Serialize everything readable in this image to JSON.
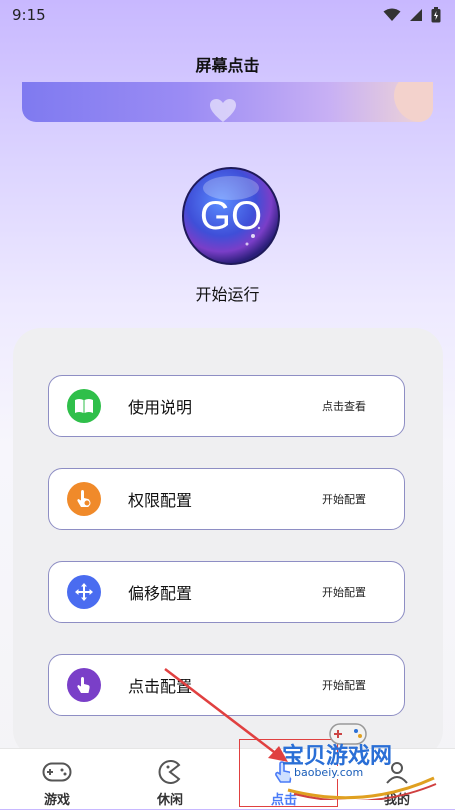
{
  "status_bar": {
    "time": "9:15"
  },
  "header": {
    "title": "屏幕点击"
  },
  "go_button": {
    "label": "GO",
    "caption": "开始运行"
  },
  "menu": [
    {
      "label": "使用说明",
      "action": "点击查看",
      "icon": "book-icon",
      "color": "#2fbf4a"
    },
    {
      "label": "权限配置",
      "action": "开始配置",
      "icon": "touch-shield-icon",
      "color": "#f08a2a"
    },
    {
      "label": "偏移配置",
      "action": "开始配置",
      "icon": "move-arrows-icon",
      "color": "#4a6cf0"
    },
    {
      "label": "点击配置",
      "action": "开始配置",
      "icon": "hand-tap-icon",
      "color": "#7a3fc8"
    }
  ],
  "nav": [
    {
      "label": "游戏",
      "icon": "gamepad-icon"
    },
    {
      "label": "休闲",
      "icon": "pacman-icon"
    },
    {
      "label": "点击",
      "icon": "tap-hand-icon",
      "active": true
    },
    {
      "label": "我的",
      "icon": "profile-icon"
    }
  ],
  "watermark": {
    "main": "宝贝游戏网",
    "sub": "baobeiy.com"
  },
  "colors": {
    "accent": "#4a7bf7",
    "annotation_red": "#e04040"
  }
}
